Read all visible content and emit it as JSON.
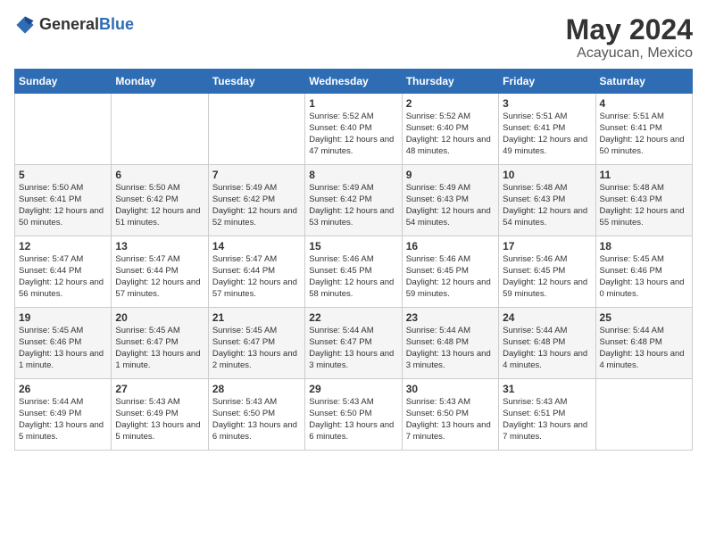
{
  "logo": {
    "general": "General",
    "blue": "Blue"
  },
  "title": "May 2024",
  "subtitle": "Acayucan, Mexico",
  "header_days": [
    "Sunday",
    "Monday",
    "Tuesday",
    "Wednesday",
    "Thursday",
    "Friday",
    "Saturday"
  ],
  "weeks": [
    [
      {
        "day": "",
        "info": ""
      },
      {
        "day": "",
        "info": ""
      },
      {
        "day": "",
        "info": ""
      },
      {
        "day": "1",
        "info": "Sunrise: 5:52 AM\nSunset: 6:40 PM\nDaylight: 12 hours and 47 minutes."
      },
      {
        "day": "2",
        "info": "Sunrise: 5:52 AM\nSunset: 6:40 PM\nDaylight: 12 hours and 48 minutes."
      },
      {
        "day": "3",
        "info": "Sunrise: 5:51 AM\nSunset: 6:41 PM\nDaylight: 12 hours and 49 minutes."
      },
      {
        "day": "4",
        "info": "Sunrise: 5:51 AM\nSunset: 6:41 PM\nDaylight: 12 hours and 50 minutes."
      }
    ],
    [
      {
        "day": "5",
        "info": "Sunrise: 5:50 AM\nSunset: 6:41 PM\nDaylight: 12 hours and 50 minutes."
      },
      {
        "day": "6",
        "info": "Sunrise: 5:50 AM\nSunset: 6:42 PM\nDaylight: 12 hours and 51 minutes."
      },
      {
        "day": "7",
        "info": "Sunrise: 5:49 AM\nSunset: 6:42 PM\nDaylight: 12 hours and 52 minutes."
      },
      {
        "day": "8",
        "info": "Sunrise: 5:49 AM\nSunset: 6:42 PM\nDaylight: 12 hours and 53 minutes."
      },
      {
        "day": "9",
        "info": "Sunrise: 5:49 AM\nSunset: 6:43 PM\nDaylight: 12 hours and 54 minutes."
      },
      {
        "day": "10",
        "info": "Sunrise: 5:48 AM\nSunset: 6:43 PM\nDaylight: 12 hours and 54 minutes."
      },
      {
        "day": "11",
        "info": "Sunrise: 5:48 AM\nSunset: 6:43 PM\nDaylight: 12 hours and 55 minutes."
      }
    ],
    [
      {
        "day": "12",
        "info": "Sunrise: 5:47 AM\nSunset: 6:44 PM\nDaylight: 12 hours and 56 minutes."
      },
      {
        "day": "13",
        "info": "Sunrise: 5:47 AM\nSunset: 6:44 PM\nDaylight: 12 hours and 57 minutes."
      },
      {
        "day": "14",
        "info": "Sunrise: 5:47 AM\nSunset: 6:44 PM\nDaylight: 12 hours and 57 minutes."
      },
      {
        "day": "15",
        "info": "Sunrise: 5:46 AM\nSunset: 6:45 PM\nDaylight: 12 hours and 58 minutes."
      },
      {
        "day": "16",
        "info": "Sunrise: 5:46 AM\nSunset: 6:45 PM\nDaylight: 12 hours and 59 minutes."
      },
      {
        "day": "17",
        "info": "Sunrise: 5:46 AM\nSunset: 6:45 PM\nDaylight: 12 hours and 59 minutes."
      },
      {
        "day": "18",
        "info": "Sunrise: 5:45 AM\nSunset: 6:46 PM\nDaylight: 13 hours and 0 minutes."
      }
    ],
    [
      {
        "day": "19",
        "info": "Sunrise: 5:45 AM\nSunset: 6:46 PM\nDaylight: 13 hours and 1 minute."
      },
      {
        "day": "20",
        "info": "Sunrise: 5:45 AM\nSunset: 6:47 PM\nDaylight: 13 hours and 1 minute."
      },
      {
        "day": "21",
        "info": "Sunrise: 5:45 AM\nSunset: 6:47 PM\nDaylight: 13 hours and 2 minutes."
      },
      {
        "day": "22",
        "info": "Sunrise: 5:44 AM\nSunset: 6:47 PM\nDaylight: 13 hours and 3 minutes."
      },
      {
        "day": "23",
        "info": "Sunrise: 5:44 AM\nSunset: 6:48 PM\nDaylight: 13 hours and 3 minutes."
      },
      {
        "day": "24",
        "info": "Sunrise: 5:44 AM\nSunset: 6:48 PM\nDaylight: 13 hours and 4 minutes."
      },
      {
        "day": "25",
        "info": "Sunrise: 5:44 AM\nSunset: 6:48 PM\nDaylight: 13 hours and 4 minutes."
      }
    ],
    [
      {
        "day": "26",
        "info": "Sunrise: 5:44 AM\nSunset: 6:49 PM\nDaylight: 13 hours and 5 minutes."
      },
      {
        "day": "27",
        "info": "Sunrise: 5:43 AM\nSunset: 6:49 PM\nDaylight: 13 hours and 5 minutes."
      },
      {
        "day": "28",
        "info": "Sunrise: 5:43 AM\nSunset: 6:50 PM\nDaylight: 13 hours and 6 minutes."
      },
      {
        "day": "29",
        "info": "Sunrise: 5:43 AM\nSunset: 6:50 PM\nDaylight: 13 hours and 6 minutes."
      },
      {
        "day": "30",
        "info": "Sunrise: 5:43 AM\nSunset: 6:50 PM\nDaylight: 13 hours and 7 minutes."
      },
      {
        "day": "31",
        "info": "Sunrise: 5:43 AM\nSunset: 6:51 PM\nDaylight: 13 hours and 7 minutes."
      },
      {
        "day": "",
        "info": ""
      }
    ]
  ]
}
